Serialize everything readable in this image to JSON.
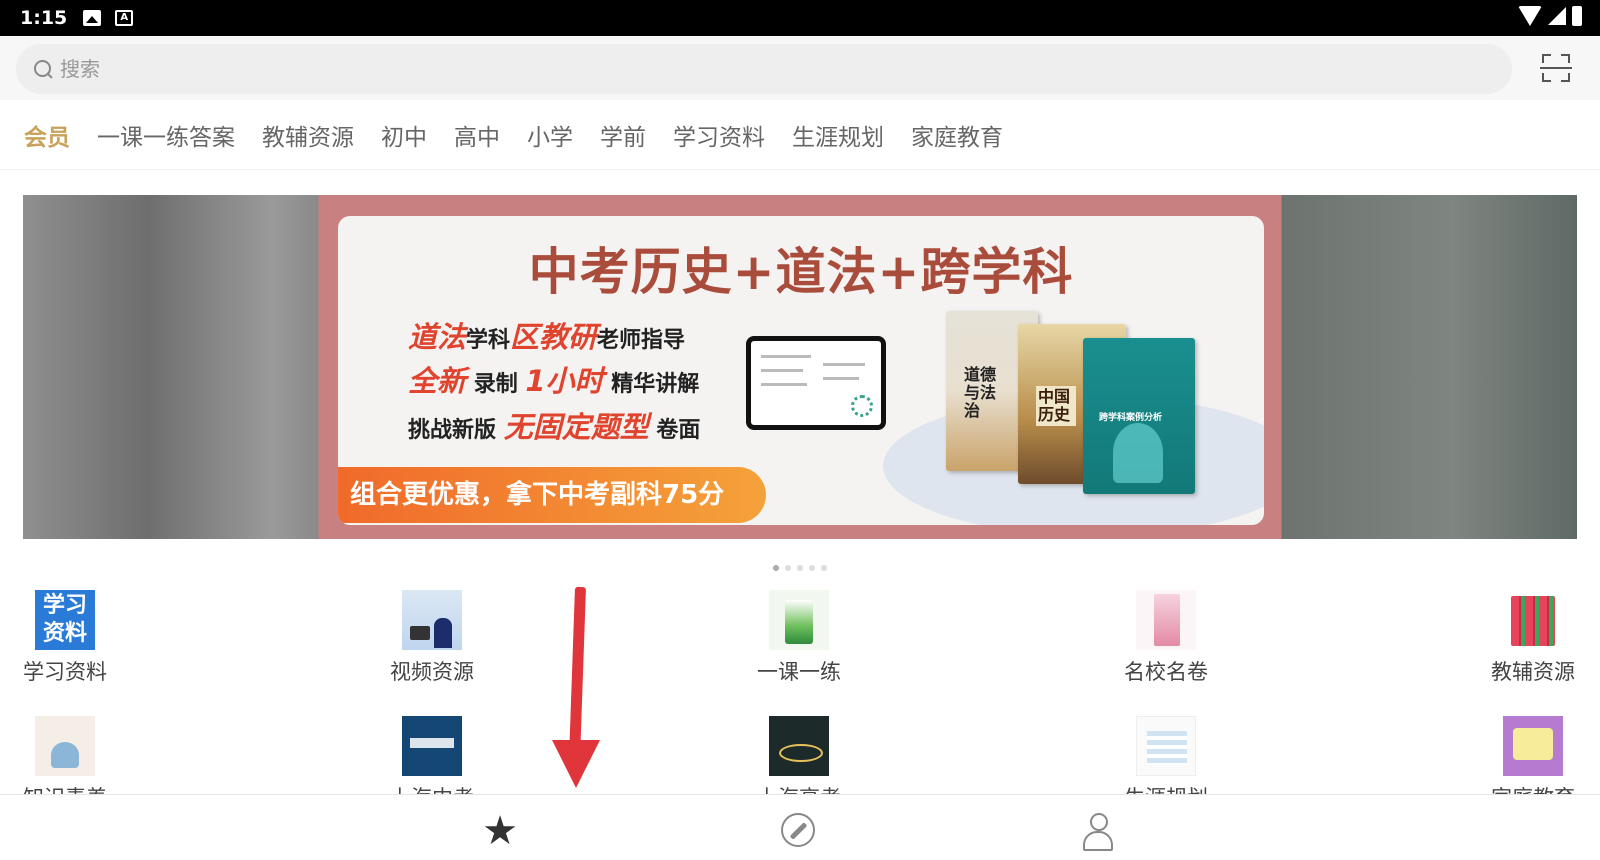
{
  "status_bar": {
    "time": "1:15",
    "icons": [
      "image-icon",
      "a-icon",
      "wifi-icon",
      "signal-icon",
      "battery-icon"
    ]
  },
  "search": {
    "placeholder": "搜索",
    "scan_icon": "scan-icon"
  },
  "tabs": [
    {
      "label": "会员",
      "active": true
    },
    {
      "label": "一课一练答案"
    },
    {
      "label": "教辅资源"
    },
    {
      "label": "初中"
    },
    {
      "label": "高中"
    },
    {
      "label": "小学"
    },
    {
      "label": "学前"
    },
    {
      "label": "学习资料"
    },
    {
      "label": "生涯规划"
    },
    {
      "label": "家庭教育"
    }
  ],
  "banner": {
    "title": "中考历史+道法+跨学科",
    "line1": {
      "a": "道法",
      "b": "学科",
      "c": "区教研",
      "d": "老师指导"
    },
    "line2": {
      "a": "全新",
      "b": "录制",
      "c": "1小时",
      "d": "精华讲解"
    },
    "line3": {
      "a": "挑战新版",
      "b": "无固定题型",
      "c": "卷面"
    },
    "cta": "组合更优惠，拿下中考副科75分",
    "book1_label": "道德与法治",
    "book2_label": "中国历史",
    "book3_label": "跨学科案例分析",
    "page_count": 5,
    "active_page": 1
  },
  "grid": [
    {
      "label": "学习资料",
      "thumb_text": "学习资料"
    },
    {
      "label": "视频资源"
    },
    {
      "label": "一课一练"
    },
    {
      "label": "名校名卷"
    },
    {
      "label": "教辅资源"
    },
    {
      "label": "知识素养"
    },
    {
      "label": "上海中考"
    },
    {
      "label": "上海高考"
    },
    {
      "label": "生涯规划"
    },
    {
      "label": "家庭教育"
    }
  ],
  "bottom_nav": [
    {
      "icon": "star-icon",
      "active": true
    },
    {
      "icon": "compass-icon"
    },
    {
      "icon": "user-icon"
    }
  ],
  "colors": {
    "active_tab": "#c9a25a",
    "annotation_arrow": "#e0363b",
    "cta_orange": "#f06a2a"
  }
}
